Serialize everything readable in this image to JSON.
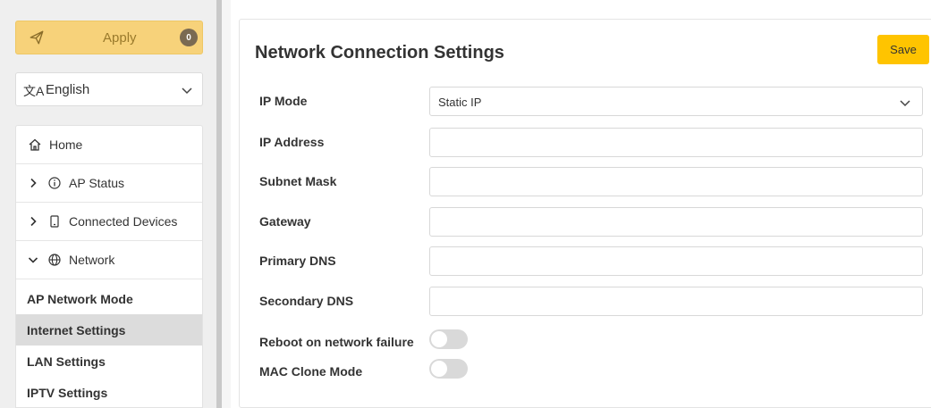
{
  "sidebar": {
    "apply": {
      "label": "Apply",
      "badge": "0",
      "icon": "send-icon"
    },
    "language": {
      "icon": "translate-icon",
      "label": "English"
    },
    "nav": {
      "home": {
        "label": "Home",
        "icon": "home-icon"
      },
      "ap_status": {
        "label": "AP Status",
        "icon": "info-icon"
      },
      "connected_devices": {
        "label": "Connected Devices",
        "icon": "device-icon"
      },
      "network": {
        "label": "Network",
        "icon": "globe-icon"
      },
      "network_items": [
        {
          "label": "AP Network Mode"
        },
        {
          "label": "Internet Settings",
          "active": true
        },
        {
          "label": "LAN Settings"
        },
        {
          "label": "IPTV Settings"
        }
      ]
    }
  },
  "main": {
    "title": "Network Connection Settings",
    "save_label": "Save",
    "fields": {
      "ip_mode": {
        "label": "IP Mode",
        "value": "Static IP"
      },
      "ip_address": {
        "label": "IP Address",
        "value": ""
      },
      "subnet_mask": {
        "label": "Subnet Mask",
        "value": ""
      },
      "gateway": {
        "label": "Gateway",
        "value": ""
      },
      "primary_dns": {
        "label": "Primary DNS",
        "value": ""
      },
      "secondary_dns": {
        "label": "Secondary DNS",
        "value": ""
      }
    },
    "toggles": {
      "reboot": {
        "label": "Reboot on network failure",
        "on": false
      },
      "mac_clone": {
        "label": "MAC Clone Mode",
        "on": false
      }
    }
  },
  "colors": {
    "apply_bg": "#f7d27a",
    "save_bg": "#ffc400",
    "active_item_bg": "#dcdcdc",
    "badge_bg": "#7a6a52"
  }
}
